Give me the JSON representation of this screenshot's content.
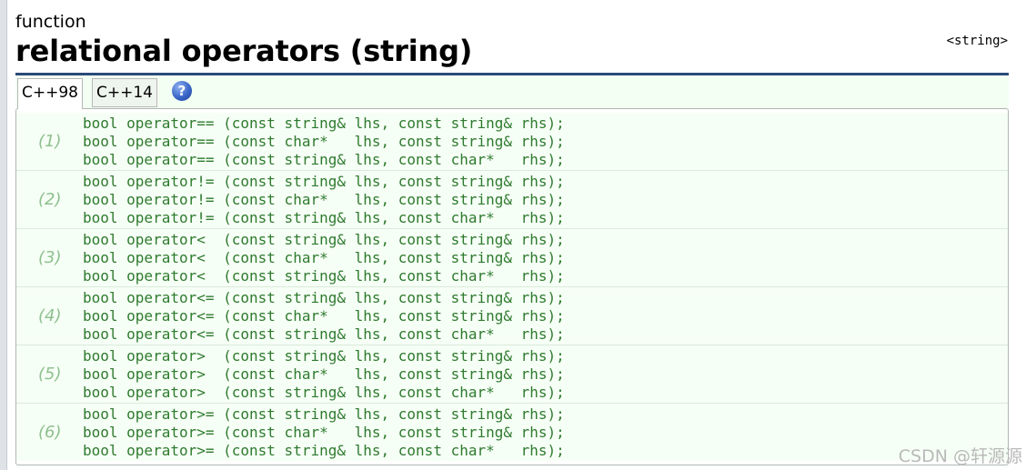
{
  "header": {
    "kind": "function",
    "title": "relational operators (string)",
    "header_tag": "<string>"
  },
  "tabs": [
    {
      "label": "C++98",
      "active": true
    },
    {
      "label": "C++14",
      "active": false
    }
  ],
  "help_icon": {
    "icon": "question-circle-icon",
    "glyph": "?"
  },
  "groups": [
    {
      "number": "(1)",
      "lines": [
        "bool operator== (const string& lhs, const string& rhs);",
        "bool operator== (const char*   lhs, const string& rhs);",
        "bool operator== (const string& lhs, const char*   rhs);"
      ]
    },
    {
      "number": "(2)",
      "lines": [
        "bool operator!= (const string& lhs, const string& rhs);",
        "bool operator!= (const char*   lhs, const string& rhs);",
        "bool operator!= (const string& lhs, const char*   rhs);"
      ]
    },
    {
      "number": "(3)",
      "lines": [
        "bool operator<  (const string& lhs, const string& rhs);",
        "bool operator<  (const char*   lhs, const string& rhs);",
        "bool operator<  (const string& lhs, const char*   rhs);"
      ]
    },
    {
      "number": "(4)",
      "lines": [
        "bool operator<= (const string& lhs, const string& rhs);",
        "bool operator<= (const char*   lhs, const string& rhs);",
        "bool operator<= (const string& lhs, const char*   rhs);"
      ]
    },
    {
      "number": "(5)",
      "lines": [
        "bool operator>  (const string& lhs, const string& rhs);",
        "bool operator>  (const char*   lhs, const string& rhs);",
        "bool operator>  (const string& lhs, const char*   rhs);"
      ]
    },
    {
      "number": "(6)",
      "lines": [
        "bool operator>= (const string& lhs, const string& rhs);",
        "bool operator>= (const char*   lhs, const string& rhs);",
        "bool operator>= (const string& lhs, const char*   rhs);"
      ]
    }
  ],
  "watermark": "CSDN @轩源源",
  "colors": {
    "code": "#2f7a2f",
    "group_number": "#8fc08f",
    "title_rule": "#2b4a7a",
    "tab_bar_bg": "#f2fff2"
  }
}
